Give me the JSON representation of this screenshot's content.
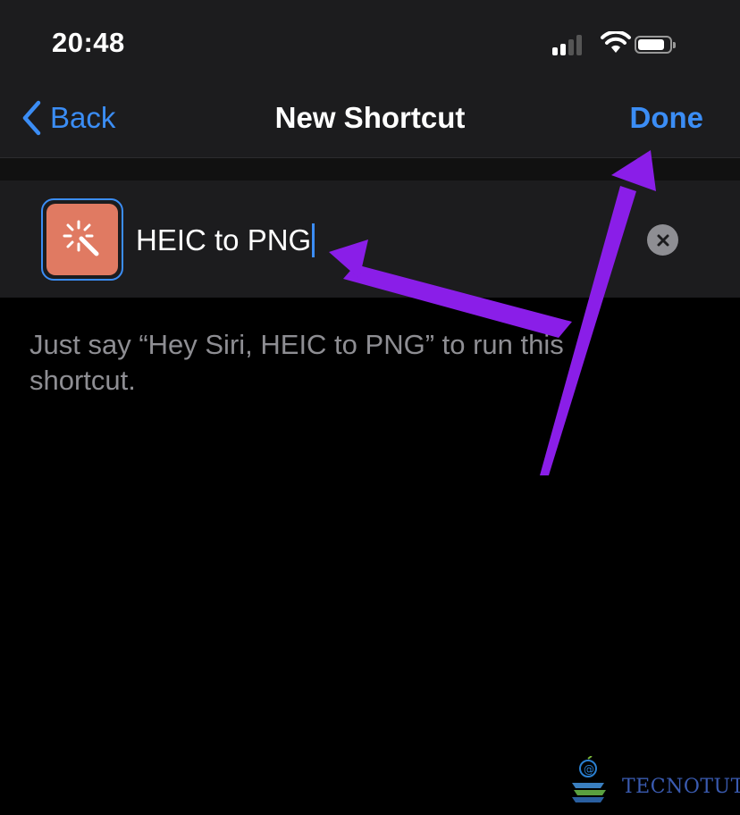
{
  "status_bar": {
    "time": "20:48"
  },
  "nav": {
    "back_label": "Back",
    "title": "New Shortcut",
    "done_label": "Done"
  },
  "shortcut": {
    "name": "HEIC to PNG",
    "icon": "magic-wand-icon",
    "icon_color": "#e07a62"
  },
  "hint": "Just say “Hey Siri, HEIC to PNG” to run this shortcut.",
  "watermark": {
    "text": "TECNOTUTO"
  },
  "colors": {
    "accent": "#3b8df5",
    "annotation_arrow": "#8a1ee8"
  }
}
